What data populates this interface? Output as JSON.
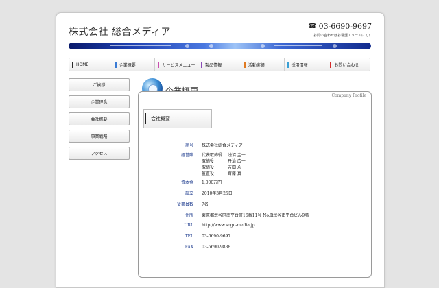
{
  "header": {
    "logo": "株式会社 総合メディア",
    "phone_icon": "phone-icon",
    "phone": "03-6690-9697",
    "phone_note": "お問い合わせはお電話・メールにて！"
  },
  "nav": [
    {
      "label": "HOME",
      "color": "#2a2a2a"
    },
    {
      "label": "企業概要",
      "color": "#3a7bd5"
    },
    {
      "label": "サービスメニュー",
      "color": "#c94fb0"
    },
    {
      "label": "製品情報",
      "color": "#8a4bb8"
    },
    {
      "label": "活動実績",
      "color": "#e07a22"
    },
    {
      "label": "採用情報",
      "color": "#3aa0d5"
    },
    {
      "label": "お問い合わせ",
      "color": "#d52a2a"
    }
  ],
  "sidebar": [
    {
      "label": "ご挨拶"
    },
    {
      "label": "企業理念"
    },
    {
      "label": "会社概要"
    },
    {
      "label": "事業戦略"
    },
    {
      "label": "アクセス"
    }
  ],
  "section": {
    "title": "企業概要",
    "subtitle_en": "Company Profile",
    "subhead": "会社概要"
  },
  "profile": {
    "name_label": "商号",
    "name_value": "株式会社総合メディア",
    "officers_label": "経営陣",
    "officers": [
      {
        "role": "代表取締役",
        "name": "浅沼 圭一"
      },
      {
        "role": "取締役",
        "name": "丹治 広一"
      },
      {
        "role": "取締役",
        "name": "吉田 永"
      },
      {
        "role": "監査役",
        "name": "齊藤 真"
      }
    ],
    "capital_label": "資本金",
    "capital_value": "1,000万円",
    "founded_label": "設立",
    "founded_value": "2010年3月25日",
    "employees_label": "従業員数",
    "employees_value": "7名",
    "address_label": "住所",
    "address_value": "東京都渋谷区南平台町16番11号 No.R渋谷南平台ビル9階",
    "url_label": "URL",
    "url_value": "http://www.sogo-media.jp",
    "tel_label": "TEL",
    "tel_value": "03-6690-9697",
    "fax_label": "FAX",
    "fax_value": "03-6690-9838"
  }
}
